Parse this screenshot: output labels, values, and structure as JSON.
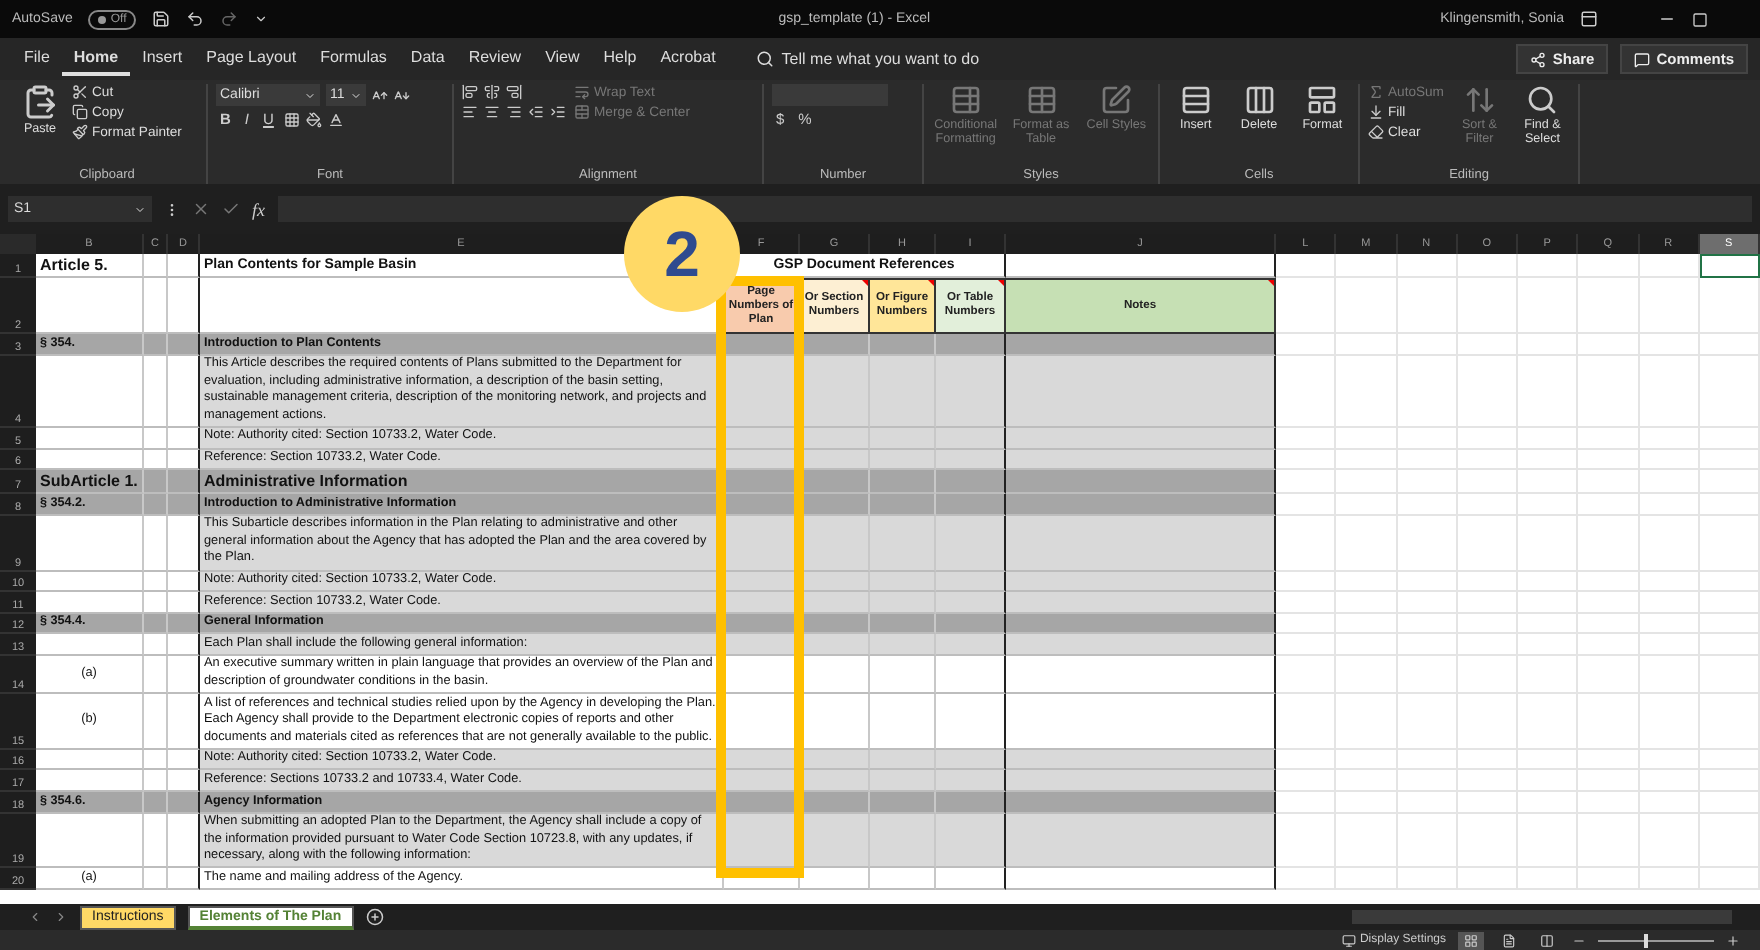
{
  "title_bar": {
    "autosave": {
      "label": "AutoSave",
      "toggle": "Off",
      "on": false
    },
    "title": "gsp_template (1)  -  Excel",
    "user": "Klingensmith, Sonia"
  },
  "menu_tabs": [
    {
      "label": "File",
      "selected": false
    },
    {
      "label": "Home",
      "selected": true
    },
    {
      "label": "Insert",
      "selected": false
    },
    {
      "label": "Page Layout",
      "selected": false
    },
    {
      "label": "Formulas",
      "selected": false
    },
    {
      "label": "Data",
      "selected": false
    },
    {
      "label": "Review",
      "selected": false
    },
    {
      "label": "View",
      "selected": false
    },
    {
      "label": "Help",
      "selected": false
    },
    {
      "label": "Acrobat",
      "selected": false
    }
  ],
  "tell_me": "Tell me what you want to do",
  "share": "Share",
  "comments": "Comments",
  "ribbon": [
    {
      "kind": "clipboard",
      "label": "Clipboard",
      "buttons": [
        {
          "kind": "large",
          "label": "Paste",
          "disabled": false
        },
        {
          "kind": "small",
          "label": "Cut",
          "disabled": false
        },
        {
          "kind": "small",
          "label": "Copy",
          "disabled": false
        },
        {
          "kind": "small",
          "label": "Format Painter",
          "disabled": false
        }
      ]
    },
    {
      "kind": "font",
      "label": "Font",
      "buttons": [
        {
          "kind": "field",
          "label": "Calibri"
        },
        {
          "kind": "field",
          "label": "11"
        },
        {
          "kind": "glyph",
          "label": "B"
        },
        {
          "kind": "glyph",
          "label": "I"
        },
        {
          "kind": "glyph",
          "label": "U"
        }
      ]
    },
    {
      "kind": "alignment",
      "label": "Alignment",
      "buttons": [
        {
          "kind": "small",
          "label": "Wrap Text",
          "disabled": true
        },
        {
          "kind": "small",
          "label": "Merge & Center",
          "disabled": true
        }
      ]
    },
    {
      "kind": "number",
      "label": "Number",
      "buttons": [
        {
          "kind": "field"
        },
        {
          "kind": "glyph",
          "label": "$"
        },
        {
          "kind": "glyph",
          "label": "%"
        }
      ]
    },
    {
      "kind": "styles",
      "label": "Styles",
      "buttons": [
        {
          "kind": "large",
          "label": "Conditional Formatting",
          "disabled": true
        },
        {
          "kind": "large",
          "label": "Format as Table",
          "disabled": true
        },
        {
          "kind": "large",
          "label": "Cell Styles",
          "disabled": true
        }
      ]
    },
    {
      "kind": "cells",
      "label": "Cells",
      "buttons": [
        {
          "kind": "large",
          "label": "Insert",
          "disabled": false
        },
        {
          "kind": "large",
          "label": "Delete",
          "disabled": false
        },
        {
          "kind": "large",
          "label": "Format",
          "disabled": false
        }
      ]
    },
    {
      "kind": "editing",
      "label": "Editing",
      "buttons": [
        {
          "kind": "small",
          "label": "AutoSum",
          "disabled": true
        },
        {
          "kind": "small",
          "label": "Fill",
          "disabled": false
        },
        {
          "kind": "small",
          "label": "Clear",
          "disabled": false
        },
        {
          "kind": "large",
          "label": "Sort & Filter",
          "disabled": true
        },
        {
          "kind": "large",
          "label": "Find & Select",
          "disabled": false
        }
      ]
    }
  ],
  "formula_bar": {
    "name_box": "S1",
    "function_label": "fx"
  },
  "columns": [
    {
      "letter": "B",
      "selected": false
    },
    {
      "letter": "C",
      "selected": false
    },
    {
      "letter": "D",
      "selected": false
    },
    {
      "letter": "E",
      "selected": false
    },
    {
      "letter": "F",
      "selected": false
    },
    {
      "letter": "G",
      "selected": false
    },
    {
      "letter": "H",
      "selected": false
    },
    {
      "letter": "I",
      "selected": false
    },
    {
      "letter": "J",
      "selected": false
    },
    {
      "letter": "L",
      "selected": false
    },
    {
      "letter": "M",
      "selected": false
    },
    {
      "letter": "N",
      "selected": false
    },
    {
      "letter": "O",
      "selected": false
    },
    {
      "letter": "P",
      "selected": false
    },
    {
      "letter": "Q",
      "selected": false
    },
    {
      "letter": "R",
      "selected": false
    },
    {
      "letter": "S",
      "selected": true
    }
  ],
  "title_row": {
    "number": "1",
    "article": "Article 5.",
    "title": "Plan Contents for Sample Basin",
    "references_heading": "GSP Document References"
  },
  "header_row": {
    "number": "2",
    "headers": [
      {
        "label": "Page Numbers of Plan",
        "color": "#f8cbad"
      },
      {
        "label": "Or Section Numbers",
        "color": "#fdefd3"
      },
      {
        "label": "Or Figure Numbers",
        "color": "#ffe699"
      },
      {
        "label": "Or Table Numbers",
        "color": "#e2efda"
      },
      {
        "label": "Notes",
        "color": "#c6e0b4"
      }
    ]
  },
  "rows": [
    {
      "number": "3",
      "kind": "section",
      "ref": "§ 354.",
      "text": "Introduction to Plan Contents"
    },
    {
      "number": "4",
      "kind": "note",
      "text": "This Article describes the required contents of Plans submitted to the Department for evaluation, including administrative information, a description of the basin setting, sustainable management criteria, description of the monitoring network, and projects and management actions."
    },
    {
      "number": "5",
      "kind": "note",
      "text": "Note: Authority cited: Section 10733.2, Water Code."
    },
    {
      "number": "6",
      "kind": "note",
      "text": "Reference: Section 10733.2, Water Code."
    },
    {
      "number": "7",
      "kind": "subarticle",
      "ref": "SubArticle 1.",
      "text": "Administrative Information"
    },
    {
      "number": "8",
      "kind": "section",
      "ref": "§ 354.2.",
      "text": "Introduction to Administrative Information"
    },
    {
      "number": "9",
      "kind": "note",
      "text": "This Subarticle describes information in the Plan relating to administrative and other general information about the Agency that has adopted the Plan and the area covered by the Plan."
    },
    {
      "number": "10",
      "kind": "note",
      "text": "Note: Authority cited: Section 10733.2, Water Code."
    },
    {
      "number": "11",
      "kind": "note",
      "text": "Reference: Section 10733.2, Water Code."
    },
    {
      "number": "12",
      "kind": "section",
      "ref": "§ 354.4.",
      "text": "General Information"
    },
    {
      "number": "13",
      "kind": "note",
      "text": "Each Plan shall include the following general information:"
    },
    {
      "number": "14",
      "kind": "item",
      "ref": "(a)",
      "text": "An executive summary written in plain language that provides an overview of the Plan and description of groundwater conditions in the basin."
    },
    {
      "number": "15",
      "kind": "item",
      "ref": "(b)",
      "text": "A list of references and technical studies relied upon by the Agency in developing the Plan.  Each Agency shall provide to the Department electronic copies of reports and other documents and materials cited as references that are not generally available to the public."
    },
    {
      "number": "16",
      "kind": "note",
      "text": "Note: Authority cited: Section 10733.2, Water Code."
    },
    {
      "number": "17",
      "kind": "note",
      "text": "Reference: Sections 10733.2 and 10733.4, Water Code."
    },
    {
      "number": "18",
      "kind": "section",
      "ref": "§ 354.6.",
      "text": "Agency Information"
    },
    {
      "number": "19",
      "kind": "note",
      "text": "When submitting an adopted Plan to the Department, the Agency shall include a copy of the information provided pursuant to Water Code Section 10723.8, with any updates, if necessary, along with the following information:"
    },
    {
      "number": "20",
      "kind": "item",
      "ref": "(a)",
      "text": "The name and mailing address of the Agency."
    }
  ],
  "callout": {
    "number": "2"
  },
  "sheet_tabs": [
    {
      "label": "Instructions",
      "selected": false,
      "color": "#ffd966"
    },
    {
      "label": "Elements of The Plan",
      "selected": true,
      "color": "#548235"
    }
  ],
  "status_bar": {
    "display_settings": "Display Settings",
    "views": [
      {
        "selected": true
      },
      {
        "selected": false
      },
      {
        "selected": false
      }
    ],
    "zoom_slider": {
      "level": 0.4
    }
  }
}
